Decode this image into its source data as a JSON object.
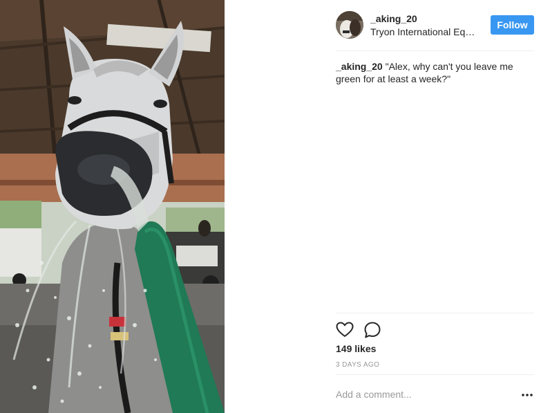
{
  "post": {
    "image_alt": "Grey horse drinking from a spraying green garden hose in a barn",
    "user": {
      "username": "_aking_20",
      "location": "Tryon International Equestrian Center"
    },
    "follow_label": "Follow",
    "caption": {
      "username": "_aking_20",
      "text": "\"Alex, why can't you leave me green for at least a week?\""
    },
    "likes": "149 likes",
    "timestamp": "3 DAYS AGO",
    "comment_placeholder": "Add a comment..."
  },
  "icons": {
    "like": "heart-icon",
    "comment": "comment-bubble-icon",
    "more": "more-options-icon"
  },
  "colors": {
    "follow_button": "#3897f0",
    "text": "#262626",
    "muted": "#999999",
    "divider": "#efefef"
  }
}
